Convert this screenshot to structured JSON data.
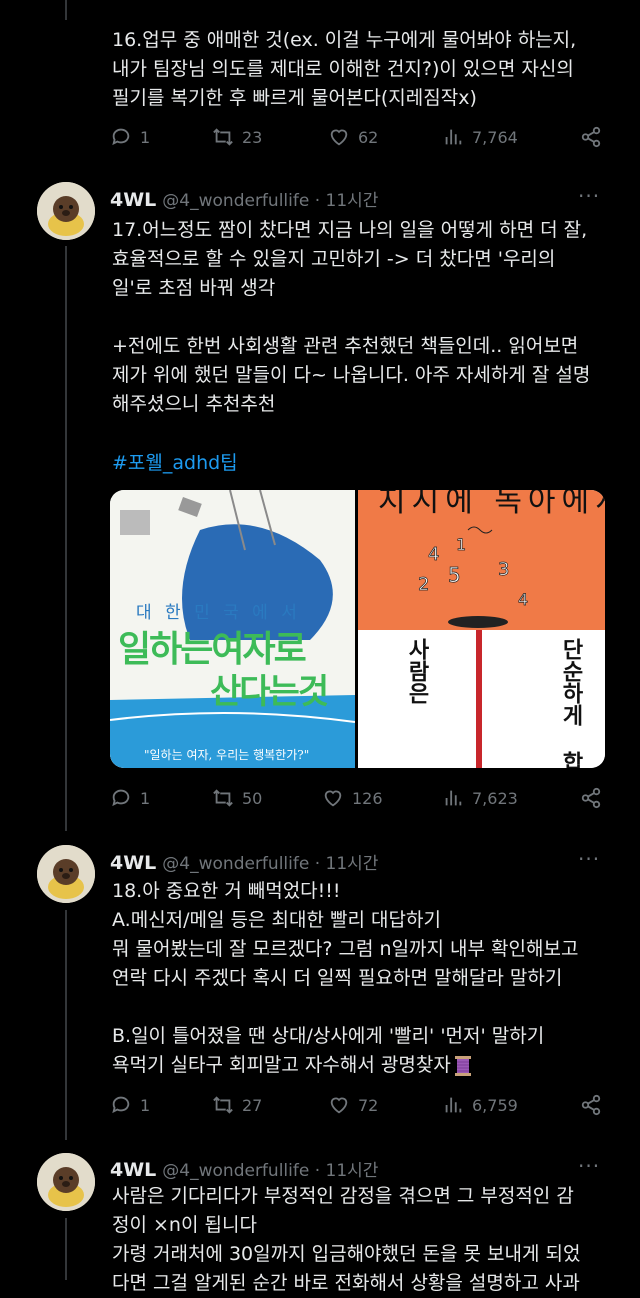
{
  "tweet16": {
    "lines": [
      "16.업무 중 애매한 것(ex. 이걸 누구에게 물어봐야 하는지,",
      "내가 팀장님 의도를 제대로 이해한 건지?)이 있으면 자신의",
      "필기를 복기한 후 빠르게 물어본다(지레짐작x)"
    ],
    "replies": "1",
    "retweets": "23",
    "likes": "62",
    "views": "7,764"
  },
  "tweet17": {
    "name": "4WL",
    "handle": "@4_wonderfullife · 11시간",
    "lines": [
      "17.어느정도 짬이 찼다면 지금 나의 일을 어떻게 하면 더 잘,",
      "효율적으로 할 수 있을지 고민하기 -> 더 찼다면 '우리의",
      "일'로 초점 바꿔 생각",
      "",
      "+전에도 한번 사회생활 관련 추천했던 책들인데.. 읽어보면",
      "제가 위에 했던 말들이 다~ 나옵니다. 아주 자세하게 잘 설명",
      "해주셨으니 추천추천"
    ],
    "hashtag": "#포웰_adhd팁",
    "book1": {
      "top": "대 한 민 국 에 서",
      "title1": "일하는여자로",
      "title2": "산다는것",
      "bottom": "\"일하는 여자, 우리는 행복한가?\""
    },
    "book2": {
      "top": "지시에 녹아에서",
      "left_vertical": "사람은",
      "right_vertical": "단순하게 합니"
    },
    "replies": "1",
    "retweets": "50",
    "likes": "126",
    "views": "7,623"
  },
  "tweet18": {
    "name": "4WL",
    "handle": "@4_wonderfullife · 11시간",
    "lines": [
      "18.아 중요한 거 빼먹었다!!!",
      "A.메신저/메일 등은 최대한 빨리 대답하기",
      "뭐 물어봤는데 잘 모르겠다? 그럼 n일까지 내부 확인해보고",
      "연락 다시 주겠다 혹시 더 일찍 필요하면 말해달라 말하기",
      "",
      "B.일이 틀어졌을 땐 상대/상사에게 '빨리' '먼저' 말하기",
      "욕먹기 실타구 회피말고 자수해서 광명찾자"
    ],
    "replies": "1",
    "retweets": "27",
    "likes": "72",
    "views": "6,759"
  },
  "tweet19": {
    "name": "4WL",
    "handle": "@4_wonderfullife · 11시간",
    "lines": [
      "사람은 기다리다가 부정적인 감정을 겪으면 그 부정적인 감",
      "정이 ×n이 됩니다",
      "가령 거래처에 30일까지 입금해야했던 돈을 못 보내게 되었",
      "다면 그걸 알게된 순간 바로 전화해서 상황을 설명하고 사과"
    ]
  },
  "more_label": "···",
  "colors": {
    "bg": "#000000",
    "text": "#e7e9ea",
    "muted": "#71767b",
    "link": "#1d9bf0"
  }
}
